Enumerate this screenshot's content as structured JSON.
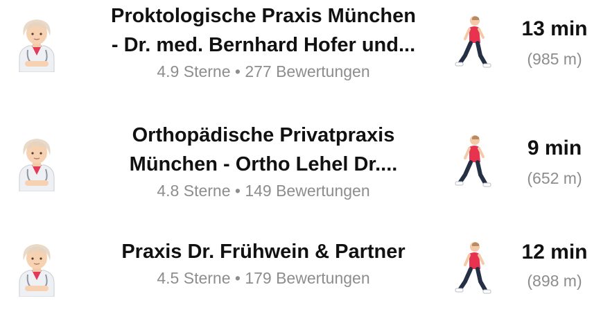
{
  "results": [
    {
      "title_line1": "Proktologische Praxis München",
      "title_line2": "- Dr. med. Bernhard Hofer und...",
      "rating": "4.9 Sterne • 277 Bewertungen",
      "walk_time": "13 min",
      "distance": "(985 m)",
      "doctor_icon": "health-worker-icon",
      "walk_icon": "person-walking-icon"
    },
    {
      "title_line1": "Orthopädische Privatpraxis",
      "title_line2": "München - Ortho Lehel Dr....",
      "rating": "4.8 Sterne • 149 Bewertungen",
      "walk_time": "9 min",
      "distance": "(652 m)",
      "doctor_icon": "health-worker-icon",
      "walk_icon": "person-walking-icon"
    },
    {
      "title_line1": "Praxis Dr. Frühwein & Partner",
      "rating": "4.5 Sterne • 179 Bewertungen",
      "walk_time": "12 min",
      "distance": "(898 m)",
      "doctor_icon": "health-worker-icon",
      "walk_icon": "person-walking-icon"
    }
  ]
}
